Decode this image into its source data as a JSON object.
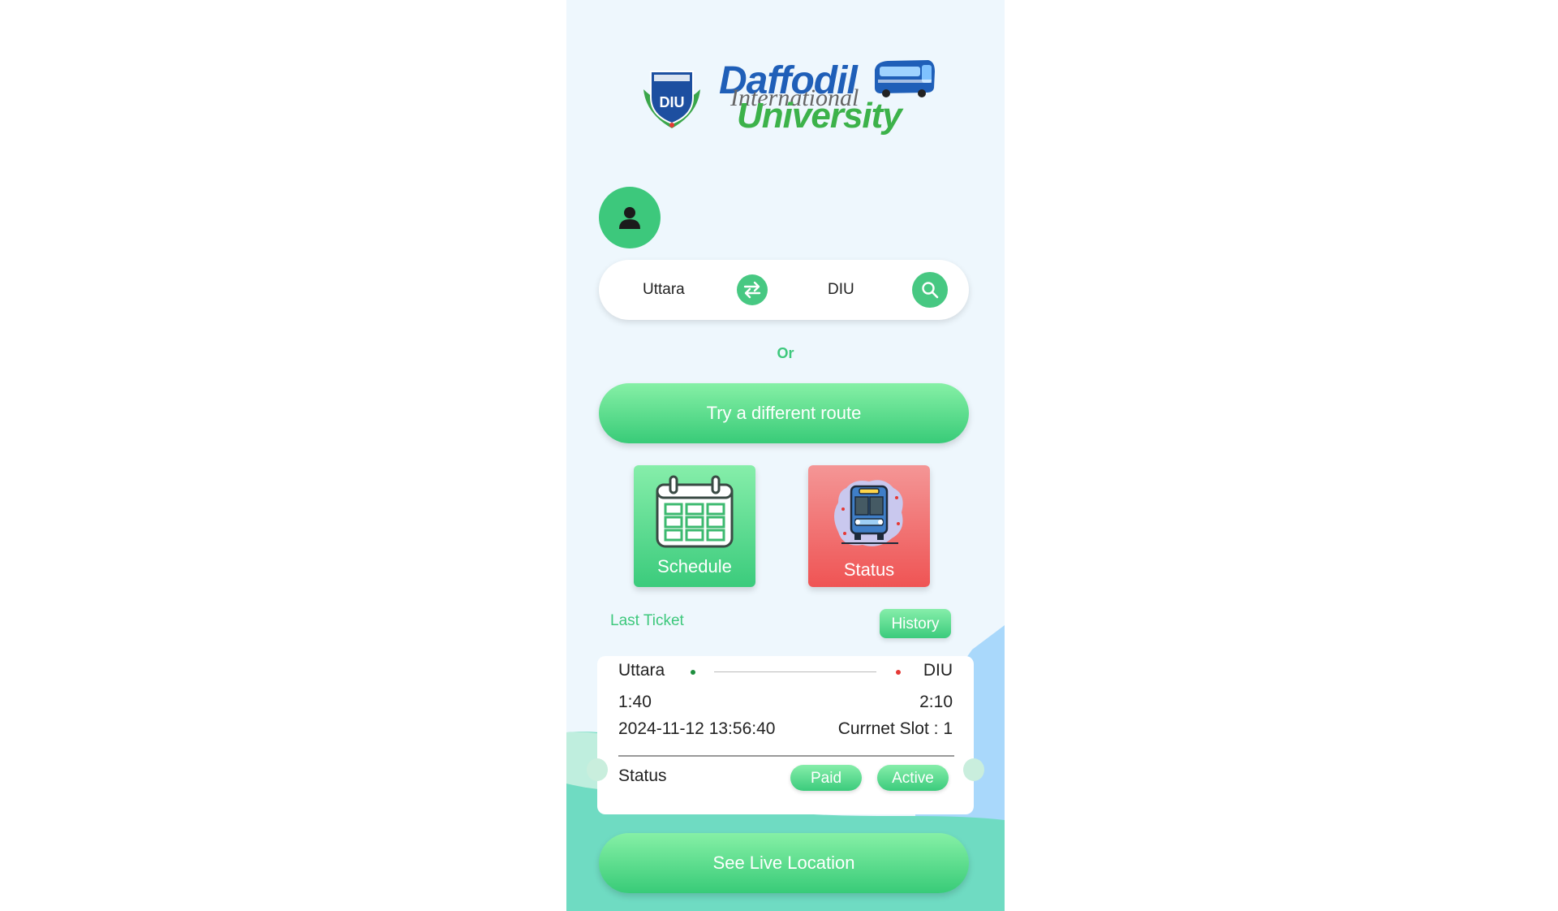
{
  "logo": {
    "line1": "Daffodil",
    "line2": "International",
    "line3": "University",
    "crest_text": "DIU"
  },
  "route": {
    "from": "Uttara",
    "to": "DIU"
  },
  "or_text": "Or",
  "try_route_label": "Try a different route",
  "tiles": {
    "schedule_label": "Schedule",
    "status_label": "Status"
  },
  "last_ticket": {
    "section_label": "Last Ticket",
    "history_label": "History",
    "from": "Uttara",
    "to": "DIU",
    "depart_time": "1:40",
    "arrive_time": "2:10",
    "datetime": "2024-11-12 13:56:40",
    "slot": "Currnet Slot : 1",
    "status_label": "Status",
    "payment_badge": "Paid",
    "state_badge": "Active"
  },
  "live_location_label": "See Live Location",
  "colors": {
    "accent": "#3dc87c",
    "status_red": "#ef5454",
    "background": "#eef7fd",
    "brand_blue": "#1f5fb8"
  },
  "icons": [
    "person-icon",
    "swap-icon",
    "search-icon",
    "calendar-icon",
    "bus-icon"
  ]
}
